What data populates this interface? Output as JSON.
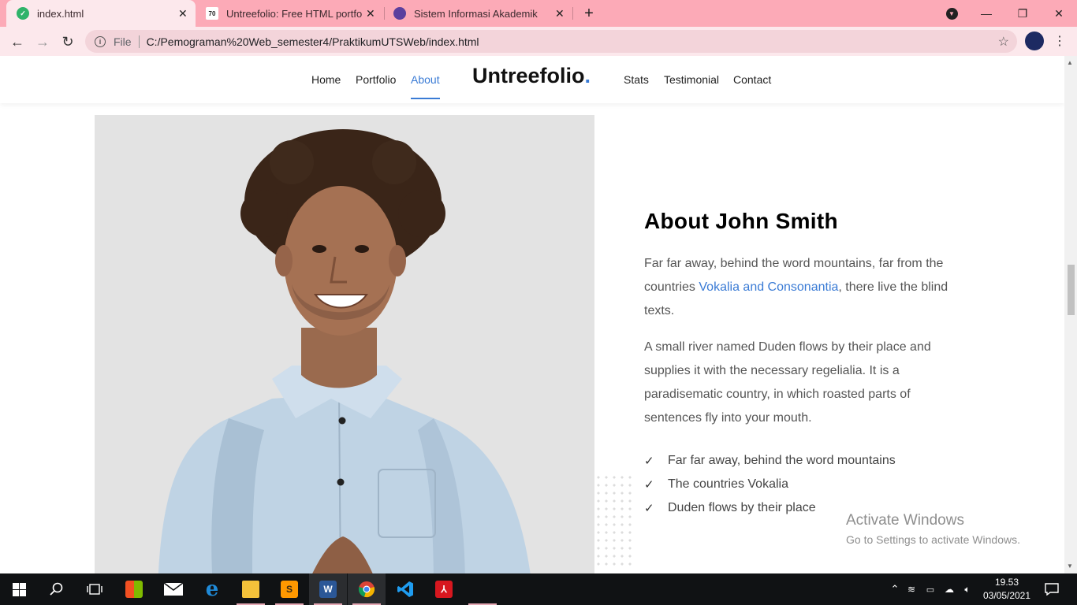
{
  "browser": {
    "tabs": [
      {
        "title": "index.html",
        "favicon": "shield-leaf-icon",
        "active": true
      },
      {
        "title": "Untreefolio: Free HTML portfolio",
        "favicon": "colorlib-icon",
        "active": false
      },
      {
        "title": "Sistem Informasi Akademik",
        "favicon": "campus-icon",
        "active": false
      }
    ],
    "address_scheme": "File",
    "url": "C:/Pemograman%20Web_semester4/PraktikumUTSWeb/index.html",
    "accent_color": "#fcaab7"
  },
  "site": {
    "nav_left": [
      "Home",
      "Portfolio",
      "About"
    ],
    "brand": "Untreefolio",
    "brand_dot": ".",
    "nav_right": [
      "Stats",
      "Testimonial",
      "Contact"
    ],
    "active_nav": "About",
    "accent_color": "#3a7bd5"
  },
  "about": {
    "title": "About John Smith",
    "para1_before": "Far far away, behind the word mountains, far from the countries ",
    "para1_link": "Vokalia and Consonantia",
    "para1_after": ", there live the blind texts.",
    "para2": "A small river named Duden flows by their place and supplies it with the necessary regelialia. It is a paradisematic country, in which roasted parts of sentences fly into your mouth.",
    "checklist": [
      "Far far away, behind the word mountains",
      "The countries Vokalia",
      "Duden flows by their place"
    ]
  },
  "watermark": {
    "line1": "Activate Windows",
    "line2": "Go to Settings to activate Windows."
  },
  "taskbar": {
    "time": "19.53",
    "date": "03/05/2021"
  }
}
